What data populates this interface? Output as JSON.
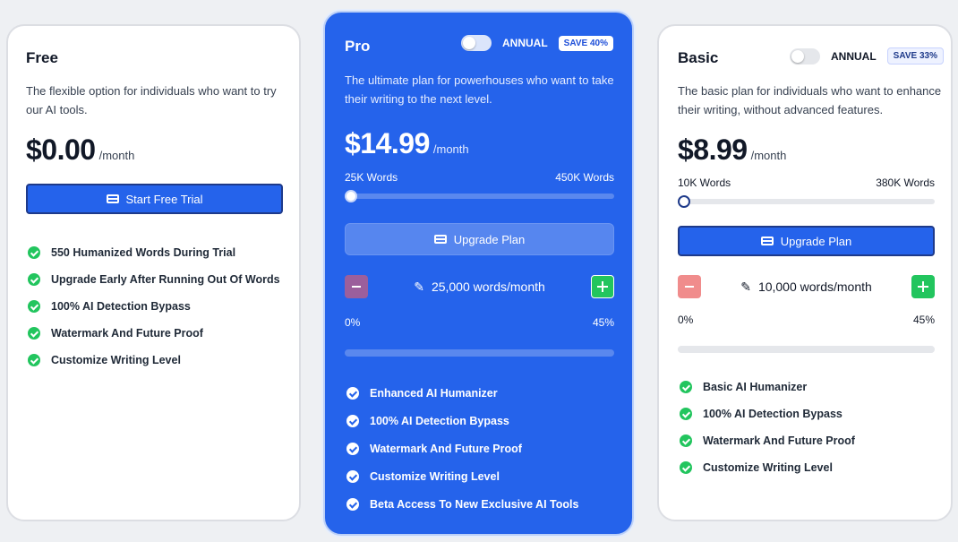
{
  "plans": {
    "free": {
      "title": "Free",
      "description": "The flexible option for individuals who want to try our AI tools.",
      "price": "$0.00",
      "period": "/month",
      "button_label": "Start Free Trial",
      "features": [
        "550 Humanized Words During Trial",
        "Upgrade Early After Running Out Of Words",
        "100% AI Detection Bypass",
        "Watermark And Future Proof",
        "Customize Writing Level"
      ]
    },
    "pro": {
      "title": "Pro",
      "annual_label": "ANNUAL",
      "save_badge": "SAVE 40%",
      "annual_toggle_on": false,
      "description": "The ultimate plan for powerhouses who want to take their writing to the next level.",
      "price": "$14.99",
      "period": "/month",
      "min_words": "25K Words",
      "max_words": "450K Words",
      "slider_value_fraction": 0,
      "button_label": "Upgrade Plan",
      "words_per_month": "25,000 words/month",
      "usage_start": "0%",
      "usage_end": "45%",
      "usage_fill_fraction": 0,
      "features": [
        "Enhanced AI Humanizer",
        "100% AI Detection Bypass",
        "Watermark And Future Proof",
        "Customize Writing Level",
        "Beta Access To New Exclusive AI Tools"
      ]
    },
    "basic": {
      "title": "Basic",
      "annual_label": "ANNUAL",
      "save_badge": "SAVE 33%",
      "annual_toggle_on": false,
      "description": "The basic plan for individuals who want to enhance their writing, without advanced features.",
      "price": "$8.99",
      "period": "/month",
      "min_words": "10K Words",
      "max_words": "380K Words",
      "slider_value_fraction": 0,
      "button_label": "Upgrade Plan",
      "words_per_month": "10,000 words/month",
      "usage_start": "0%",
      "usage_end": "45%",
      "usage_fill_fraction": 0,
      "features": [
        "Basic AI Humanizer",
        "100% AI Detection Bypass",
        "Watermark And Future Proof",
        "Customize Writing Level"
      ]
    }
  },
  "colors": {
    "primary_blue": "#2563eb",
    "check_green": "#22c55e",
    "pro_minus_button": "#9b5f9c",
    "pro_plus_button": "#22c55e",
    "basic_minus_button": "#f08c8c",
    "basic_plus_button": "#22c55e"
  },
  "icons": {
    "button_icon": "credit-card-icon",
    "feature_icon": "check-circle-icon",
    "words_icon": "pencil-icon",
    "decrement_icon": "minus-icon",
    "increment_icon": "plus-icon"
  }
}
